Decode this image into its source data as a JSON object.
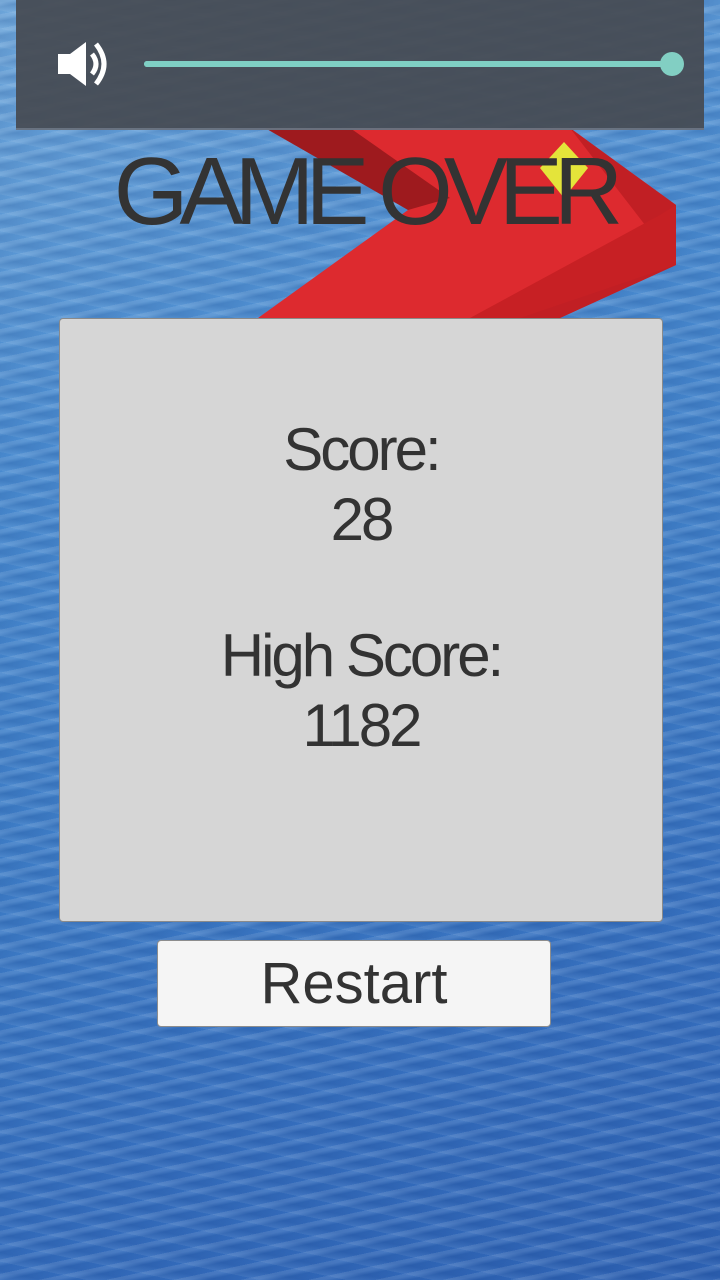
{
  "volume": {
    "level": 1.0
  },
  "title": "GAME OVER",
  "score": {
    "label": "Score:",
    "value": "28"
  },
  "high_score": {
    "label": "High Score:",
    "value": "1182"
  },
  "restart_label": "Restart",
  "colors": {
    "track_red": "#d9262b",
    "gem_yellow": "#e4e43a",
    "slider_teal": "#7fcfc4",
    "panel_gray": "#d6d6d6"
  }
}
